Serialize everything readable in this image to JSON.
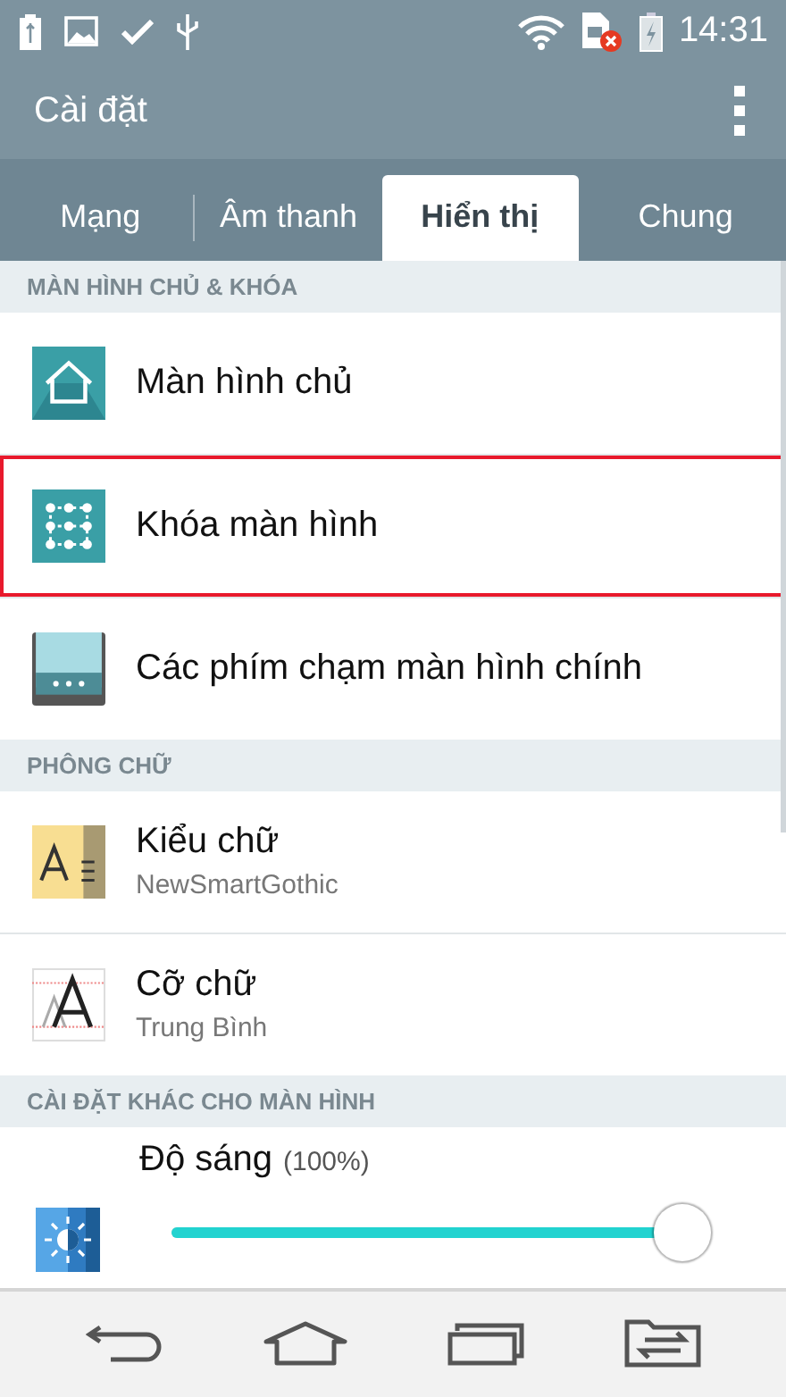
{
  "status_bar": {
    "time": "14:31"
  },
  "app_bar": {
    "title": "Cài đặt"
  },
  "tabs": [
    {
      "label": "Mạng",
      "selected": false
    },
    {
      "label": "Âm thanh",
      "selected": false
    },
    {
      "label": "Hiển thị",
      "selected": true
    },
    {
      "label": "Chung",
      "selected": false
    }
  ],
  "sections": [
    {
      "header": "MÀN HÌNH CHỦ & KHÓA",
      "items": [
        {
          "kind": "home",
          "title": "Màn hình chủ",
          "highlighted": false
        },
        {
          "kind": "lock",
          "title": "Khóa màn hình",
          "highlighted": true
        },
        {
          "kind": "keys",
          "title": "Các phím chạm màn hình chính",
          "highlighted": false
        }
      ]
    },
    {
      "header": "PHÔNG CHỮ",
      "items": [
        {
          "kind": "fonttype",
          "title": "Kiểu chữ",
          "subtitle": "NewSmartGothic",
          "highlighted": false
        },
        {
          "kind": "fontsize",
          "title": "Cỡ chữ",
          "subtitle": "Trung Bình",
          "highlighted": false
        }
      ]
    },
    {
      "header": "CÀI ĐẶT KHÁC CHO MÀN HÌNH",
      "items": [
        {
          "kind": "brightness",
          "title": "Độ sáng",
          "reading": "(100%)",
          "level": 1,
          "highlighted": false
        }
      ]
    }
  ]
}
